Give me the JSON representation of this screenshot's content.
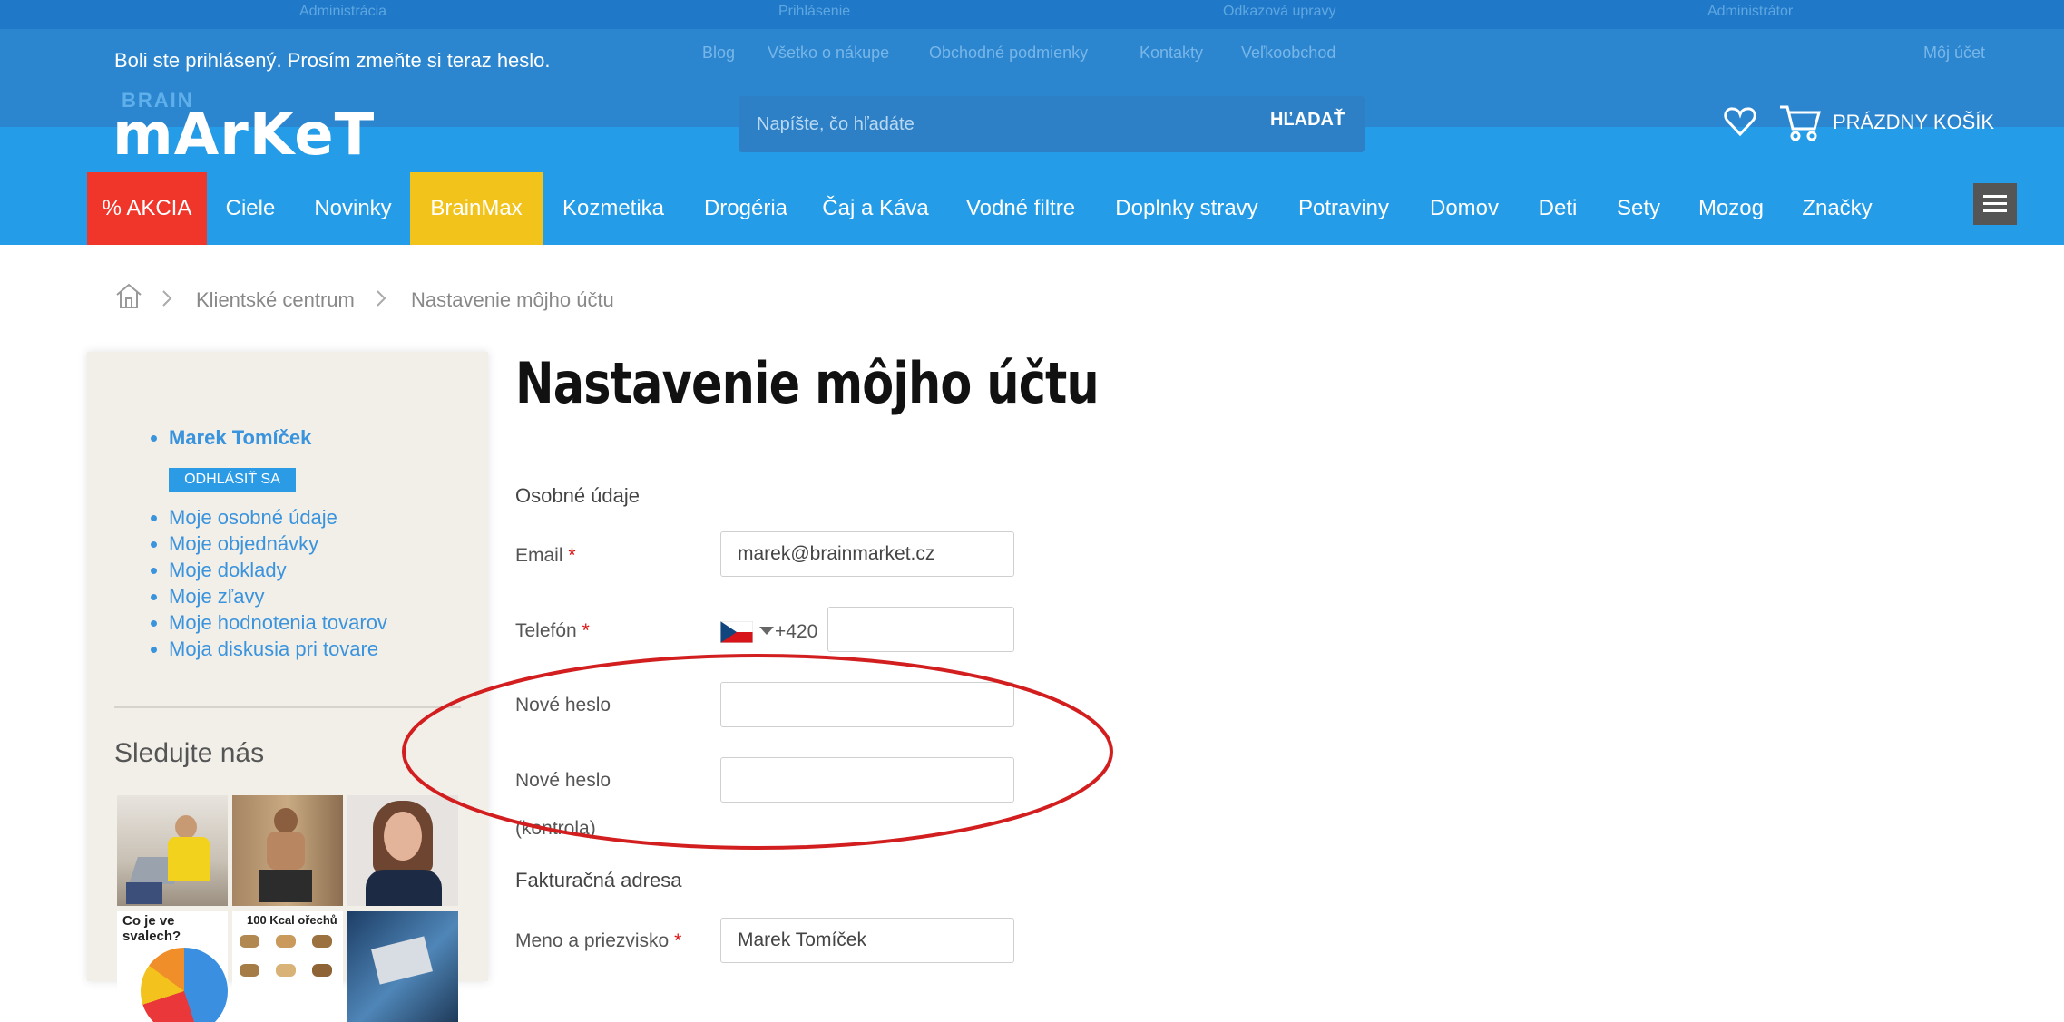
{
  "header": {
    "top_strip": [
      "Administrácia",
      "Prihlásenie",
      "Odkazová upravy",
      "Administrátor"
    ],
    "util_links": [
      "Blog",
      "Všetko o nákupe",
      "Obchodné podmienky",
      "Kontakty",
      "Veľkoobchod"
    ],
    "util_right": "Môj účet",
    "notice": "Boli ste prihlásený. Prosím zmeňte si teraz heslo.",
    "logo_top": "BRAIN",
    "logo": "mArKeT",
    "search_placeholder": "Napíšte, čo hľadáte",
    "search_button": "HĽADAŤ",
    "cart_label": "PRÁZDNY KOŠÍK"
  },
  "nav": {
    "items": [
      "% AKCIA",
      "Ciele",
      "Novinky",
      "BrainMax",
      "Kozmetika",
      "Drogéria",
      "Čaj a Káva",
      "Vodné filtre",
      "Doplnky stravy",
      "Potraviny",
      "Domov",
      "Deti",
      "Sety",
      "Mozog",
      "Značky"
    ]
  },
  "breadcrumb": {
    "items": [
      "Klientské centrum",
      "Nastavenie môjho účtu"
    ]
  },
  "sidebar": {
    "user_name": "Marek Tomíček",
    "logout": "ODHLÁSIŤ SA",
    "links": [
      "Moje osobné údaje",
      "Moje objednávky",
      "Moje doklady",
      "Moje zľavy",
      "Moje hodnotenia tovarov",
      "Moja diskusia pri tovare"
    ],
    "follow_title": "Sledujte nás",
    "thumb_captions": [
      "Co je ve svalech?",
      "100 Kcal ořechů"
    ]
  },
  "main": {
    "title": "Nastavenie môjho účtu",
    "personal_title": "Osobné údaje",
    "email_label": "Email",
    "email_value": "marek@brainmarket.cz",
    "phone_label": "Telefón",
    "phone_prefix": "+420",
    "phone_value": "",
    "new_password_label": "Nové heslo",
    "confirm_password_label_1": "Nové heslo",
    "confirm_password_label_2": "(kontrola)",
    "billing_title": "Fakturačná adresa",
    "name_label": "Meno a priezvisko",
    "name_value": "Marek Tomíček",
    "required_mark": "*"
  },
  "colors": {
    "header_blue": "#249ce7",
    "notice_blue": "#2b86cf",
    "akcia_red": "#f0362b",
    "brainmax_yellow": "#f2c31b",
    "link_blue": "#3a93dd",
    "annotation_red": "#d21e1e"
  },
  "icons": [
    "home-icon",
    "chevron-right-icon",
    "heart-icon",
    "cart-icon",
    "hamburger-icon",
    "flag-cz-icon",
    "caret-down-icon"
  ]
}
